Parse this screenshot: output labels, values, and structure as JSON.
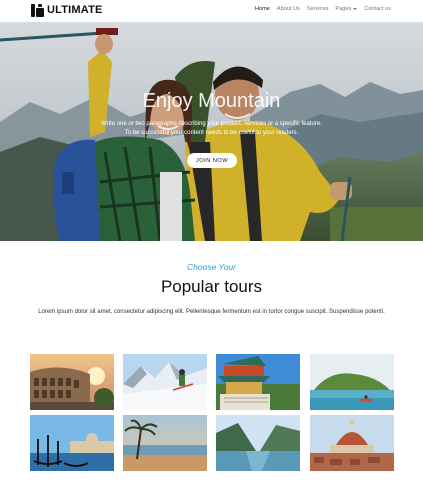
{
  "brand": {
    "name": "ULTIMATE",
    "logo_icon": "ultimate-logo-icon"
  },
  "nav": {
    "items": [
      {
        "label": "Home",
        "active": true
      },
      {
        "label": "About Us",
        "active": false
      },
      {
        "label": "Services",
        "active": false
      },
      {
        "label": "Pages",
        "active": false,
        "dropdown": true
      },
      {
        "label": "Contact us",
        "active": false
      }
    ]
  },
  "hero": {
    "title": "Enjoy Mountain",
    "subtitle_line1": "Write one or two paragraphs describing your product, services or a specific feature.",
    "subtitle_line2": "To be successful your content needs to be useful to your readers.",
    "button_label": "JOIN NOW"
  },
  "tours": {
    "kicker": "Choose Your",
    "heading": "Popular tours",
    "description": "Lorem ipsum dolor sit amet, consectetur adipiscing elit. Pellentesque fermentum est in tortor congue suscipit. Suspendisse potenti.",
    "images": [
      "colosseum-photo",
      "snow-mountain-skier-photo",
      "asian-temple-photo",
      "coastal-island-kayak-photo",
      "venice-gondolas-photo",
      "palm-beach-sunset-photo",
      "fjord-lake-photo",
      "florence-cathedral-photo"
    ]
  },
  "colors": {
    "accent": "#2d9cdb",
    "heading": "#111111",
    "hero_button_bg": "#ffffff"
  }
}
